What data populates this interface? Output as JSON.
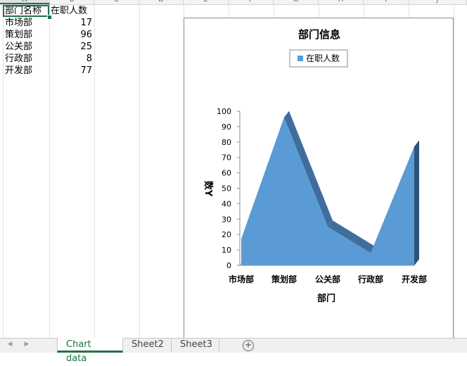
{
  "columns": [
    "A",
    "B",
    "C",
    "D",
    "E",
    "F",
    "G",
    "H",
    "I",
    "J"
  ],
  "sheet": {
    "headers": [
      "部门名称",
      "在职人数"
    ],
    "rows": [
      {
        "name": "市场部",
        "count": "17"
      },
      {
        "name": "策划部",
        "count": "96"
      },
      {
        "name": "公关部",
        "count": "25"
      },
      {
        "name": "行政部",
        "count": "8"
      },
      {
        "name": "开发部",
        "count": "77"
      }
    ]
  },
  "tabs": [
    "Chart data",
    "Sheet2",
    "Sheet3"
  ],
  "active_tab": "Chart data",
  "accent_color": "#217346",
  "chart_data": {
    "type": "area",
    "title": "部门信息",
    "categories": [
      "市场部",
      "策划部",
      "公关部",
      "行政部",
      "开发部"
    ],
    "series": [
      {
        "name": "在职人数",
        "values": [
          17,
          96,
          25,
          8,
          77
        ],
        "color": "#5b9bd5"
      }
    ],
    "xlabel": "部门",
    "ylabel": "数Y",
    "ylim": [
      0,
      100
    ],
    "yticks": [
      0,
      10,
      20,
      30,
      40,
      50,
      60,
      70,
      80,
      90,
      100
    ],
    "legend_position": "top",
    "grid": false,
    "three_d": true
  }
}
